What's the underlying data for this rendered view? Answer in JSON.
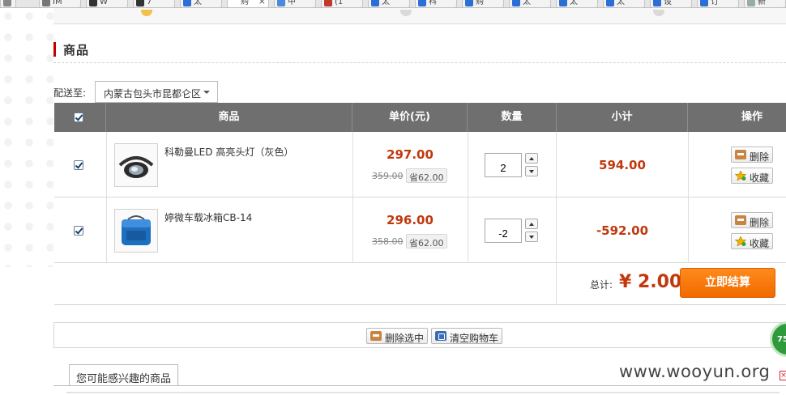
{
  "browser": {
    "tabs": [
      {
        "label": "IM",
        "active": false
      },
      {
        "label": "W",
        "active": false
      },
      {
        "label": "7",
        "active": false
      },
      {
        "label": "太",
        "active": false
      },
      {
        "label": "购",
        "active": true
      },
      {
        "label": "中",
        "active": false
      },
      {
        "label": "(1",
        "active": false
      },
      {
        "label": "太",
        "active": false
      },
      {
        "label": "科",
        "active": false
      },
      {
        "label": "购",
        "active": false
      },
      {
        "label": "太",
        "active": false
      },
      {
        "label": "太",
        "active": false
      },
      {
        "label": "太",
        "active": false
      },
      {
        "label": "设",
        "active": false
      },
      {
        "label": "订",
        "active": false
      },
      {
        "label": "途",
        "active": false
      },
      {
        "label": "新",
        "active": false
      }
    ]
  },
  "section": {
    "title": "商品"
  },
  "shipping": {
    "label": "配送至:",
    "region": "内蒙古包头市昆都仑区"
  },
  "table": {
    "headers": {
      "product": "商品",
      "unit_price": "单价(元)",
      "quantity": "数量",
      "subtotal": "小计",
      "actions": "操作"
    }
  },
  "items": [
    {
      "name": "科勒曼LED 高亮头灯（灰色）",
      "price": "297.00",
      "old_price": "359.00",
      "save": "省62.00",
      "quantity": "2",
      "subtotal": "594.00",
      "checked": true
    },
    {
      "name": "婷微车载冰箱CB-14",
      "price": "296.00",
      "old_price": "358.00",
      "save": "省62.00",
      "quantity": "-2",
      "subtotal": "-592.00",
      "checked": true
    }
  ],
  "row_actions": {
    "delete": "删除",
    "favorite": "收藏"
  },
  "summary": {
    "total_label": "总计:",
    "total_value": "¥ 2.00",
    "checkout_label": "立即结算"
  },
  "bulk_actions": {
    "delete_selected": "删除选中",
    "clear_cart": "清空购物车"
  },
  "recommend": {
    "title": "您可能感兴趣的商品"
  },
  "watermark": "www.wooyun.org",
  "float_badge": "75",
  "colors": {
    "accent_red": "#c2380e",
    "header_gray": "#6f6f6f",
    "checkout_orange": "#f06a00"
  }
}
